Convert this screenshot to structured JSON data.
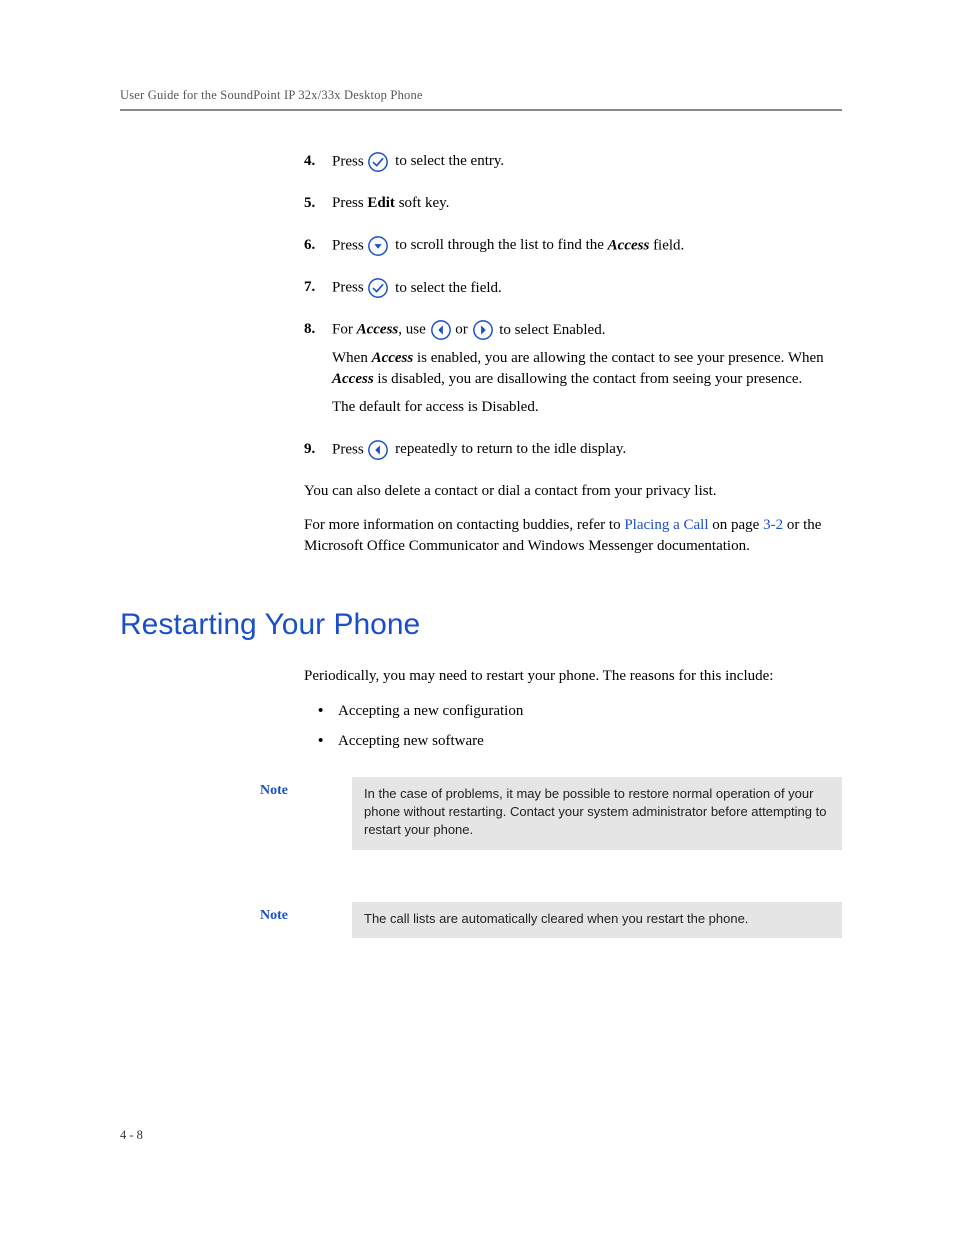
{
  "header": {
    "running_title": "User Guide for the SoundPoint IP 32x/33x Desktop Phone"
  },
  "steps": {
    "s4": {
      "num": "4.",
      "pre": "Press ",
      "post": " to select the entry."
    },
    "s5": {
      "num": "5.",
      "pre": "Press ",
      "bold": "Edit",
      "post": " soft key."
    },
    "s6": {
      "num": "6.",
      "pre": "Press ",
      "post_a": " to scroll through the list to find the ",
      "italic": "Access",
      "post_b": " field."
    },
    "s7": {
      "num": "7.",
      "pre": "Press ",
      "post": " to select the field."
    },
    "s8": {
      "num": "8.",
      "pre": "For ",
      "italic": "Access",
      "mid": ", use ",
      "or": " or ",
      "post": " to select Enabled.",
      "para2_a": "When ",
      "para2_i1": "Access",
      "para2_b": " is enabled, you are allowing the contact to see your presence. When ",
      "para2_i2": "Access",
      "para2_c": " is disabled, you are disallowing the contact from seeing your presence.",
      "para3": "The default for access is Disabled."
    },
    "s9": {
      "num": "9.",
      "pre": "Press ",
      "post": " repeatedly to return to the idle display."
    }
  },
  "paragraphs": {
    "after1": "You can also delete a contact or dial a contact from your privacy list.",
    "after2_a": "For more information on contacting buddies, refer to ",
    "after2_link": "Placing a Call",
    "after2_b": " on page ",
    "after2_pageref": "3-2",
    "after2_c": " or the Microsoft Office Communicator and Windows Messenger documentation."
  },
  "section": {
    "heading": "Restarting Your Phone",
    "intro": "Periodically, you may need to restart your phone. The reasons for this include:",
    "bullets": {
      "b1": "Accepting a new configuration",
      "b2": "Accepting new software"
    }
  },
  "notes": {
    "label": "Note",
    "n1": "In the case of problems, it may be possible to restore normal operation of your phone without restarting. Contact your system administrator before attempting to restart your phone.",
    "n2": "The call lists are automatically cleared when you restart the phone."
  },
  "footer": {
    "page_num": "4 - 8"
  }
}
